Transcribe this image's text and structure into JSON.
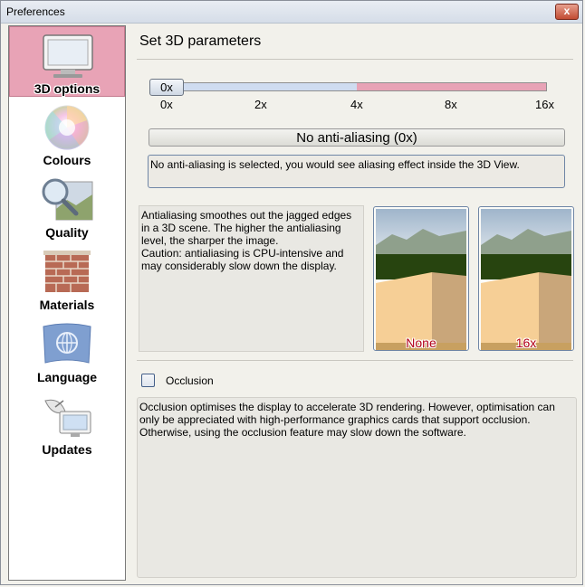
{
  "window": {
    "title": "Preferences",
    "close_label": "x"
  },
  "sidebar": {
    "items": [
      {
        "label": "3D options",
        "icon": "monitor-icon",
        "selected": true
      },
      {
        "label": "Colours",
        "icon": "color-wheel-icon",
        "selected": false
      },
      {
        "label": "Quality",
        "icon": "magnifier-icon",
        "selected": false
      },
      {
        "label": "Materials",
        "icon": "brick-wall-icon",
        "selected": false
      },
      {
        "label": "Language",
        "icon": "flag-icon",
        "selected": false
      },
      {
        "label": "Updates",
        "icon": "satellite-icon",
        "selected": false
      }
    ]
  },
  "main": {
    "heading": "Set 3D parameters",
    "antialias": {
      "current": "0x",
      "ticks": [
        "0x",
        "2x",
        "4x",
        "8x",
        "16x"
      ],
      "mode_label": "No anti-aliasing (0x)",
      "description": "No anti-aliasing is selected, you would see aliasing effect inside the 3D View.",
      "info_lines": [
        "Antialiasing smoothes out the jagged edges",
        "in a 3D scene. The higher the antialiasing",
        "level, the sharper the image.",
        "Caution: antialiasing is CPU-intensive and",
        "may considerably slow down the display."
      ],
      "previews": [
        {
          "label": "None"
        },
        {
          "label": "16x"
        }
      ]
    },
    "occlusion": {
      "label": "Occlusion",
      "checked": false,
      "description_lines": [
        "Occlusion optimises the display to accelerate 3D rendering. However, optimisation can",
        "only be appreciated with high-performance graphics cards that support occlusion.",
        "Otherwise, using the occlusion feature may slow down the software."
      ]
    }
  },
  "colors": {
    "selected_bg": "#e8a3b6",
    "preview_label": "#b2001a",
    "slider_fill": "#cfdcf0"
  }
}
